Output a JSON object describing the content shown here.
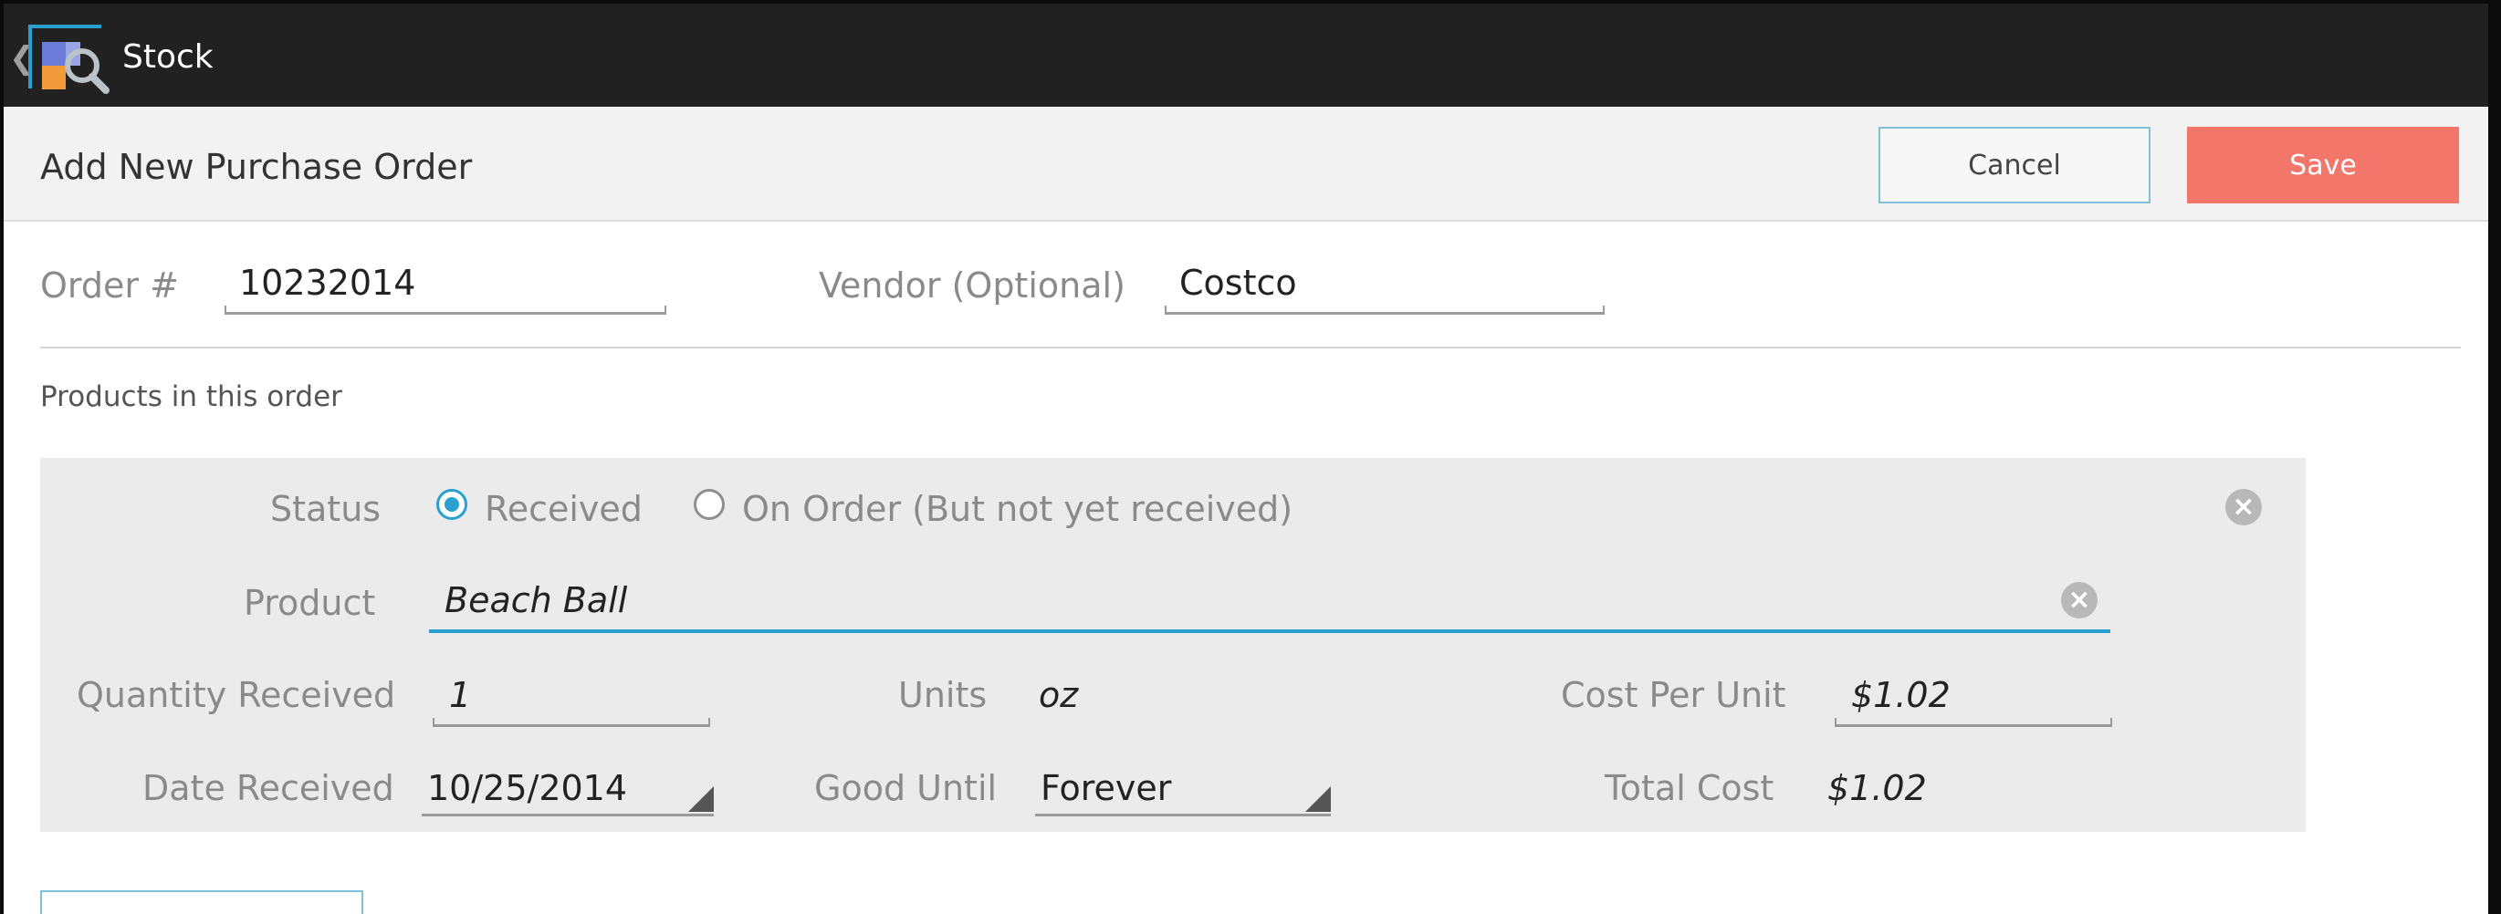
{
  "app": {
    "title": "Stock"
  },
  "header": {
    "page_title": "Add New Purchase Order",
    "cancel_label": "Cancel",
    "save_label": "Save"
  },
  "order": {
    "order_label": "Order #",
    "order_value": "10232014",
    "vendor_label": "Vendor (Optional)",
    "vendor_value": "Costco"
  },
  "products": {
    "section_title": "Products in this order",
    "item": {
      "status_label": "Status",
      "status_options": [
        "Received",
        "On Order (But not yet received)"
      ],
      "status_selected": "Received",
      "product_label": "Product",
      "product_value": "Beach Ball",
      "quantity_label": "Quantity Received",
      "quantity_value": "1",
      "units_label": "Units",
      "units_value": "oz",
      "cost_label": "Cost Per Unit",
      "cost_value": "$1.02",
      "date_label": "Date Received",
      "date_value": "10/25/2014",
      "good_until_label": "Good Until",
      "good_until_value": "Forever",
      "total_label": "Total Cost",
      "total_value": "$1.02"
    }
  },
  "colors": {
    "action_bar": "#212121",
    "accent": "#2aa0d0",
    "save_button": "#f2766a",
    "cancel_border": "#7fc1d7"
  },
  "icons": [
    "back-chevron-icon",
    "app-logo-icon",
    "clear-icon",
    "remove-item-icon",
    "spinner-arrow-icon"
  ]
}
